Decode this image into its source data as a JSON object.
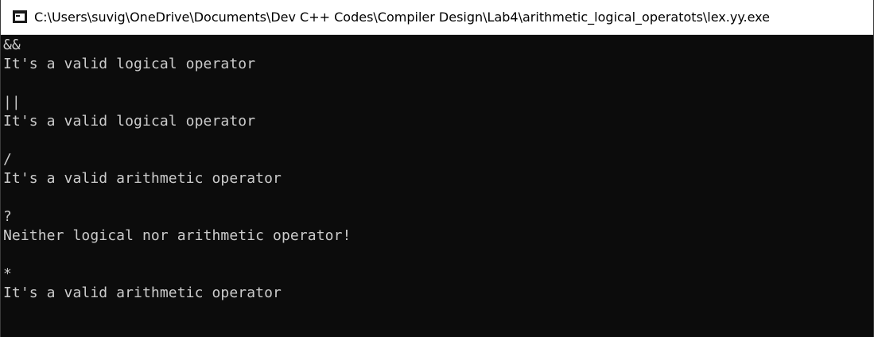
{
  "window": {
    "title": "C:\\Users\\suvig\\OneDrive\\Documents\\Dev C++ Codes\\Compiler Design\\Lab4\\arithmetic_logical_operatots\\lex.yy.exe",
    "icon": "console-app-icon"
  },
  "console": {
    "lines": [
      "&&",
      "It's a valid logical operator",
      "",
      "||",
      "It's a valid logical operator",
      "",
      "/",
      "It's a valid arithmetic operator",
      "",
      "?",
      "Neither logical nor arithmetic operator!",
      "",
      "*",
      "It's a valid arithmetic operator"
    ]
  },
  "colors": {
    "titlebar_bg": "#ffffff",
    "console_bg": "#0c0c0c",
    "console_text": "#cccccc"
  }
}
